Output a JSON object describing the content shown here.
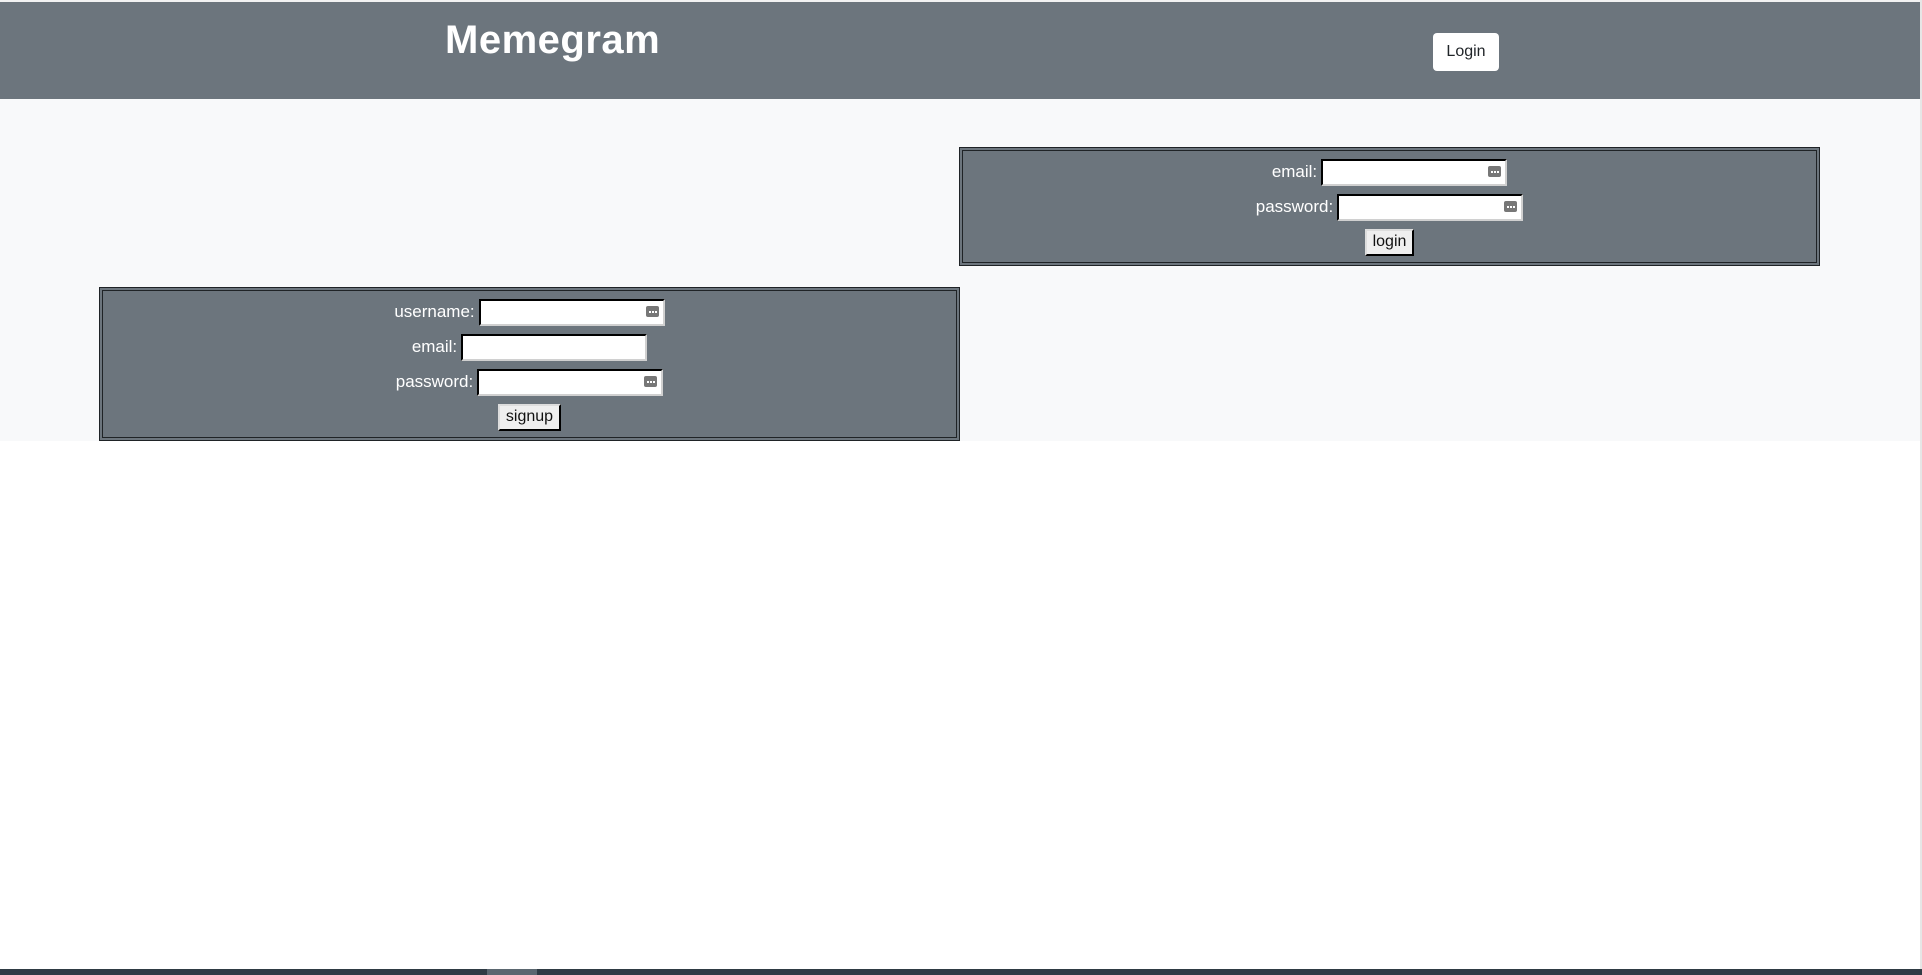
{
  "header": {
    "brand": "Memegram",
    "login_button": "Login"
  },
  "login_form": {
    "email_label": "email:",
    "email_value": "",
    "password_label": "password:",
    "password_value": "",
    "submit_label": "login"
  },
  "signup_form": {
    "username_label": "username:",
    "username_value": "",
    "email_label": "email:",
    "email_value": "",
    "password_label": "password:",
    "password_value": "",
    "submit_label": "signup"
  },
  "colors": {
    "header_bg": "#6c757d",
    "content_bg": "#f8f9fa",
    "panel_bg": "#6c757d"
  },
  "icons": {
    "password_manager": "password-manager-key-icon"
  }
}
